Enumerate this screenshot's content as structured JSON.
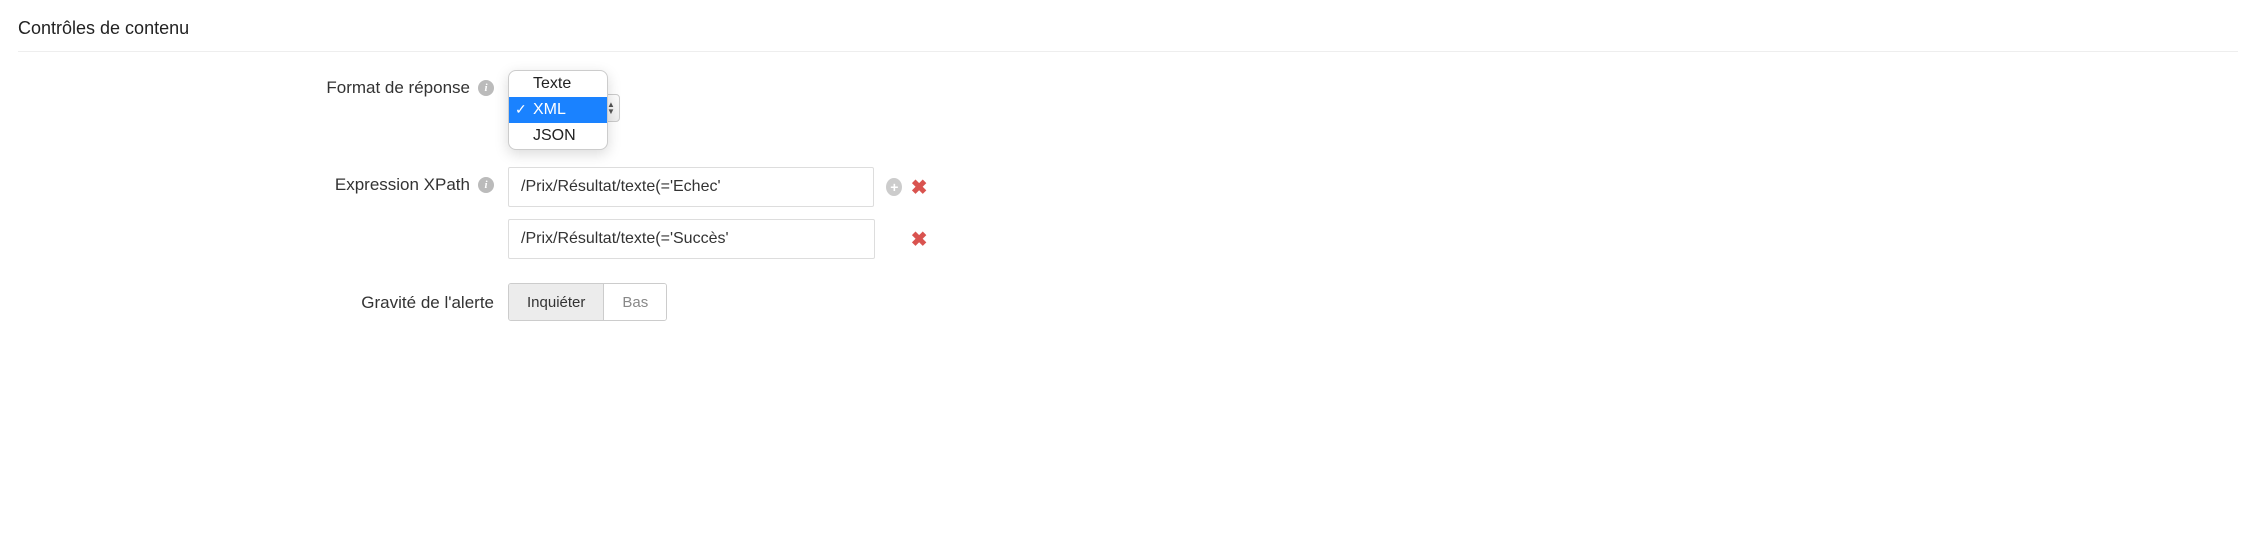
{
  "section": {
    "title": "Contrôles de contenu"
  },
  "fields": {
    "response_format": {
      "label": "Format de réponse",
      "options": [
        "Texte",
        "XML",
        "JSON"
      ],
      "selected": "XML"
    },
    "xpath": {
      "label": "Expression XPath",
      "rows": [
        {
          "value": "/Prix/Résultat/texte(='Echec'",
          "has_add": true
        },
        {
          "value": "/Prix/Résultat/texte(='Succès'",
          "has_add": false
        }
      ]
    },
    "severity": {
      "label": "Gravité de l'alerte",
      "options": [
        "Inquiéter",
        "Bas"
      ],
      "selected": "Inquiéter"
    }
  }
}
